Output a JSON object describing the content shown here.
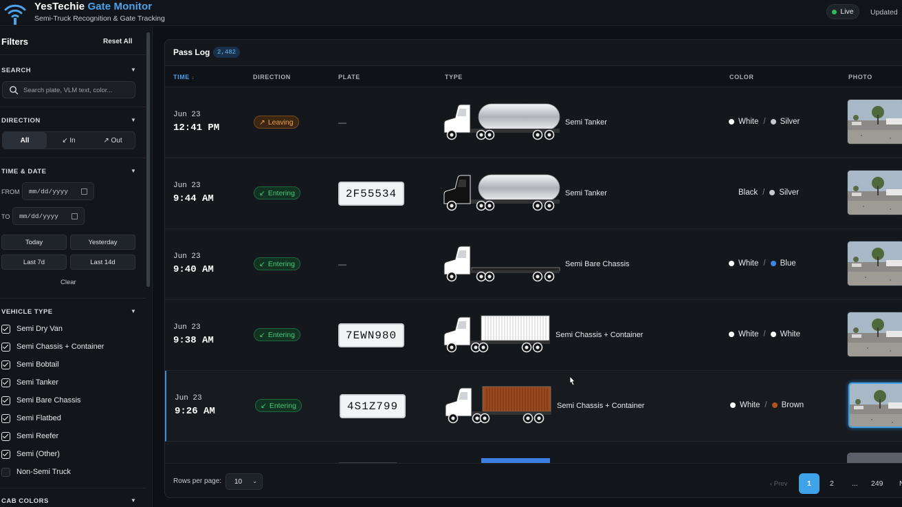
{
  "header": {
    "brand_main": "YesTechie",
    "brand_accent": "Gate Monitor",
    "subtitle": "Semi-Truck Recognition & Gate Tracking",
    "live_label": "Live",
    "updated_label": "Updated"
  },
  "colors": {
    "accent": "#4ba3ea",
    "live": "#2ebd59",
    "leaving": "#f0a245",
    "entering": "#45c979"
  },
  "sidebar": {
    "title": "Filters",
    "reset_label": "Reset All",
    "search": {
      "heading": "SEARCH",
      "placeholder": "Search plate, VLM text, color..."
    },
    "direction": {
      "heading": "DIRECTION",
      "options": [
        "All",
        "↙ In",
        "↗ Out"
      ],
      "selected": "All"
    },
    "time_date": {
      "heading": "TIME & DATE",
      "from_label": "FROM",
      "to_label": "TO",
      "from_placeholder": "mm/dd/yyyy",
      "to_placeholder": "mm/dd/yyyy",
      "quick": [
        "Today",
        "Yesterday",
        "Last 7d",
        "Last 14d"
      ],
      "clear_label": "Clear"
    },
    "vehicle_type": {
      "heading": "VEHICLE TYPE",
      "items": [
        {
          "label": "Semi Dry Van",
          "checked": true
        },
        {
          "label": "Semi Chassis + Container",
          "checked": true
        },
        {
          "label": "Semi Bobtail",
          "checked": true
        },
        {
          "label": "Semi Tanker",
          "checked": true
        },
        {
          "label": "Semi Bare Chassis",
          "checked": true
        },
        {
          "label": "Semi Flatbed",
          "checked": true
        },
        {
          "label": "Semi Reefer",
          "checked": true
        },
        {
          "label": "Semi (Other)",
          "checked": true
        },
        {
          "label": "Non-Semi Truck",
          "checked": false
        }
      ]
    },
    "cab_colors": {
      "heading": "CAB COLORS"
    }
  },
  "passlog": {
    "title": "Pass Log",
    "count": "2,482",
    "columns": {
      "time": "TIME",
      "sort_icon": "↓",
      "direction": "DIRECTION",
      "plate": "PLATE",
      "type": "TYPE",
      "color": "COLOR",
      "photo": "PHOTO"
    },
    "rows": [
      {
        "date": "Jun 23",
        "time": "12:41 PM",
        "direction": "Leaving",
        "arrow": "↗",
        "plate": "—",
        "truck": "tanker",
        "cab": "white",
        "type": "Semi Tanker",
        "cab_color": "White",
        "cab_hex": "#ffffff",
        "body_color": "Silver",
        "body_hex": "#c6c9cd"
      },
      {
        "date": "Jun 23",
        "time": "9:44 AM",
        "direction": "Entering",
        "arrow": "↙",
        "plate": "2F55534",
        "truck": "tanker",
        "cab": "black",
        "type": "Semi Tanker",
        "cab_color": "Black",
        "cab_hex": "#000000",
        "body_color": "Silver",
        "body_hex": "#c6c9cd"
      },
      {
        "date": "Jun 23",
        "time": "9:40 AM",
        "direction": "Entering",
        "arrow": "↙",
        "plate": "—",
        "truck": "chassis",
        "cab": "white",
        "type": "Semi Bare Chassis",
        "cab_color": "White",
        "cab_hex": "#ffffff",
        "body_color": "Blue",
        "body_hex": "#3f86e8"
      },
      {
        "date": "Jun 23",
        "time": "9:38 AM",
        "direction": "Entering",
        "arrow": "↙",
        "plate": "7EWN980",
        "truck": "container",
        "cab": "white",
        "container_hex": "#ffffff",
        "type": "Semi Chassis + Container",
        "cab_color": "White",
        "cab_hex": "#ffffff",
        "body_color": "White",
        "body_hex": "#ffffff"
      },
      {
        "date": "Jun 23",
        "time": "9:26 AM",
        "direction": "Entering",
        "arrow": "↙",
        "plate": "4S1Z799",
        "truck": "container",
        "cab": "white",
        "container_hex": "#9a4a1e",
        "type": "Semi Chassis + Container",
        "cab_color": "White",
        "cab_hex": "#ffffff",
        "body_color": "Brown",
        "body_hex": "#b0531f"
      }
    ]
  },
  "pagination": {
    "rows_label": "Rows per page:",
    "rows_value": "10",
    "prev_label": "‹ Prev",
    "pages": [
      "1",
      "2",
      "...",
      "249"
    ],
    "current": "1",
    "next_partial": "N"
  }
}
